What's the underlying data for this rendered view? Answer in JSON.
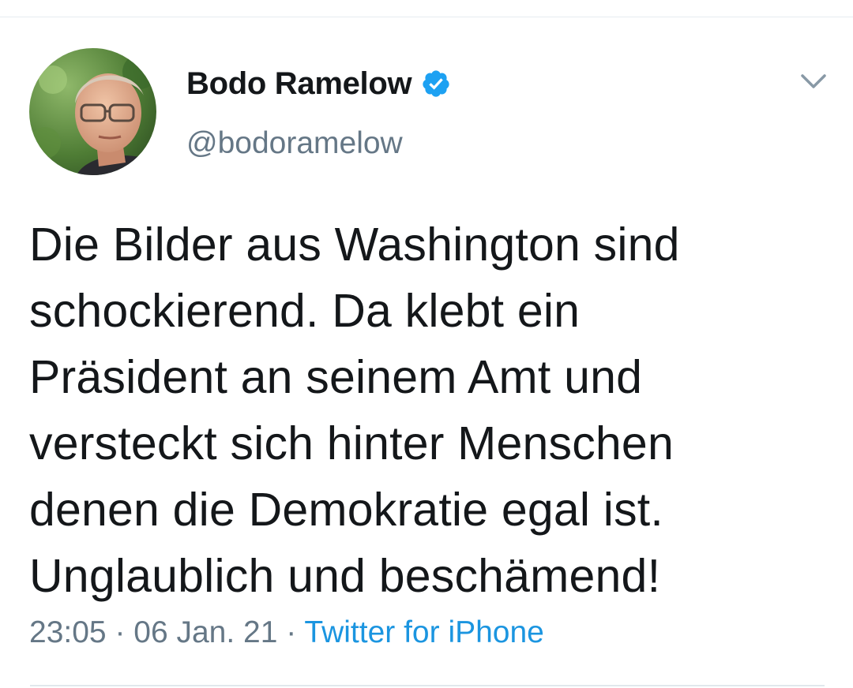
{
  "tweet": {
    "author": {
      "display_name": "Bodo Ramelow",
      "handle": "@bodoramelow",
      "verified": true,
      "avatar_icon": "profile-photo"
    },
    "text": "Die Bilder aus Washington sind\nschockierend. Da klebt ein\nPräsident an seinem Amt und\nversteckt sich hinter Menschen\ndenen die Demokratie egal ist.\nUnglaublich und beschämend!",
    "time": "23:05",
    "separator": " · ",
    "date": "06 Jan. 21",
    "source": "Twitter for iPhone",
    "menu_icon": "chevron-down-icon"
  },
  "colors": {
    "text": "#14171a",
    "secondary": "#657786",
    "link": "#1b95e0",
    "verified": "#1da1f2",
    "divider": "#e6ecf0"
  }
}
